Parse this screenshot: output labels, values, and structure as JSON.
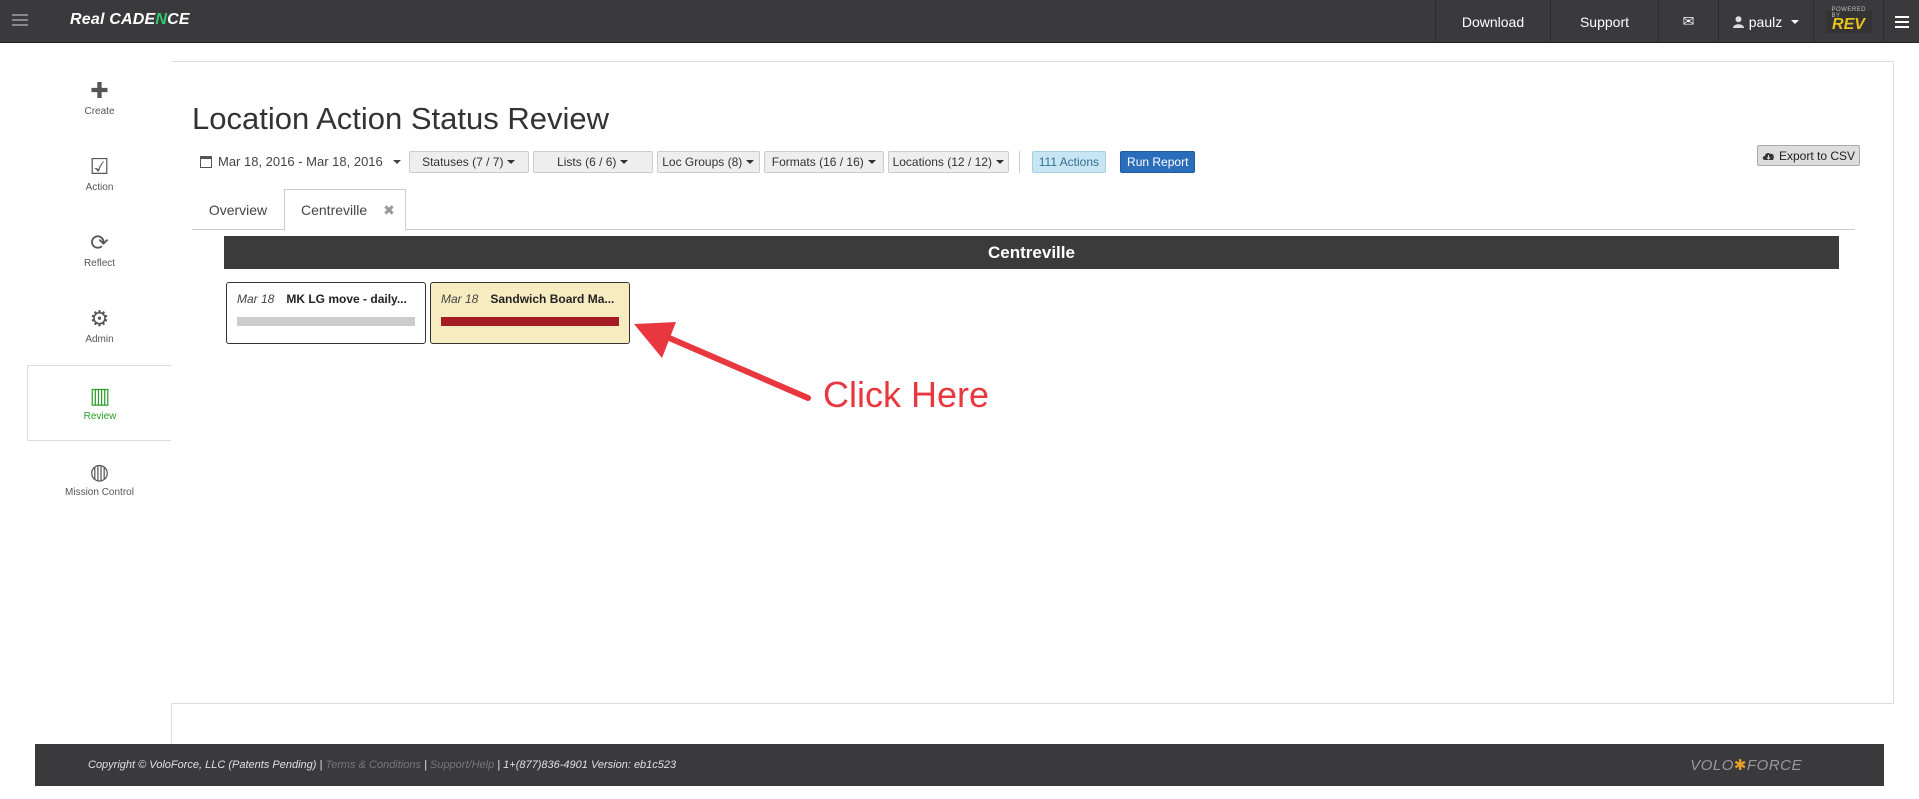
{
  "topbar": {
    "brand_prefix": "Real CADE",
    "brand_accent": "N",
    "brand_suffix": "CE",
    "download": "Download",
    "support": "Support",
    "mail_icon": "✉",
    "user": "paulz",
    "rev_top": "POWERED BY",
    "rev_logo": "REV"
  },
  "sidebar": {
    "items": [
      {
        "label": "Create",
        "icon": "✚"
      },
      {
        "label": "Action",
        "icon": "☑"
      },
      {
        "label": "Reflect",
        "icon": "⟳"
      },
      {
        "label": "Admin",
        "icon": "⚙"
      },
      {
        "label": "Review",
        "icon": "▥"
      },
      {
        "label": "Mission Control",
        "icon": "◍"
      }
    ],
    "active": "Review"
  },
  "page": {
    "title": "Location Action Status Review"
  },
  "toolbar": {
    "date_range": "Mar 18, 2016 - Mar 18, 2016",
    "filters": {
      "statuses": "Statuses (7 / 7)",
      "lists": "Lists (6 / 6)",
      "loc_groups": "Loc Groups (8)",
      "formats": "Formats (16 / 16)",
      "locations": "Locations (12 / 12)"
    },
    "actions_count": "111 Actions",
    "run_report": "Run Report",
    "export_csv": "Export to CSV"
  },
  "tabs": {
    "overview": "Overview",
    "centreville": "Centreville",
    "close_icon": "✖"
  },
  "location": {
    "name": "Centreville",
    "cards": [
      {
        "date": "Mar 18",
        "name": "MK LG move - daily..."
      },
      {
        "date": "Mar 18",
        "name": "Sandwich Board Ma..."
      }
    ]
  },
  "annotation": {
    "text": "Click Here",
    "color": "#e8373e"
  },
  "footer": {
    "copyright": "Copyright © VoloForce, LLC (Patents Pending) |",
    "terms": "Terms & Conditions",
    "sep": "|",
    "support": "Support/Help",
    "info": "| 1+(877)836-4901 Version: eb1c523",
    "logo_left": "VOLO",
    "logo_right": "FORCE"
  }
}
